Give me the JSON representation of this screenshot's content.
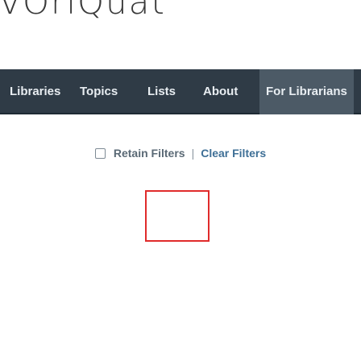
{
  "brand": {
    "text": "VOrlQuat"
  },
  "nav": {
    "items": [
      {
        "label": "Libraries"
      },
      {
        "label": "Topics"
      },
      {
        "label": "Lists"
      },
      {
        "label": "About"
      },
      {
        "label": "For Librarians"
      }
    ]
  },
  "filters": {
    "retain_label": "Retain Filters",
    "separator": "|",
    "clear_label": "Clear Filters"
  },
  "colors": {
    "navbar": "#2f3b46",
    "nav_text": "#e8edf1",
    "link": "#3e6f96",
    "focus_outline": "#e02b2b"
  }
}
